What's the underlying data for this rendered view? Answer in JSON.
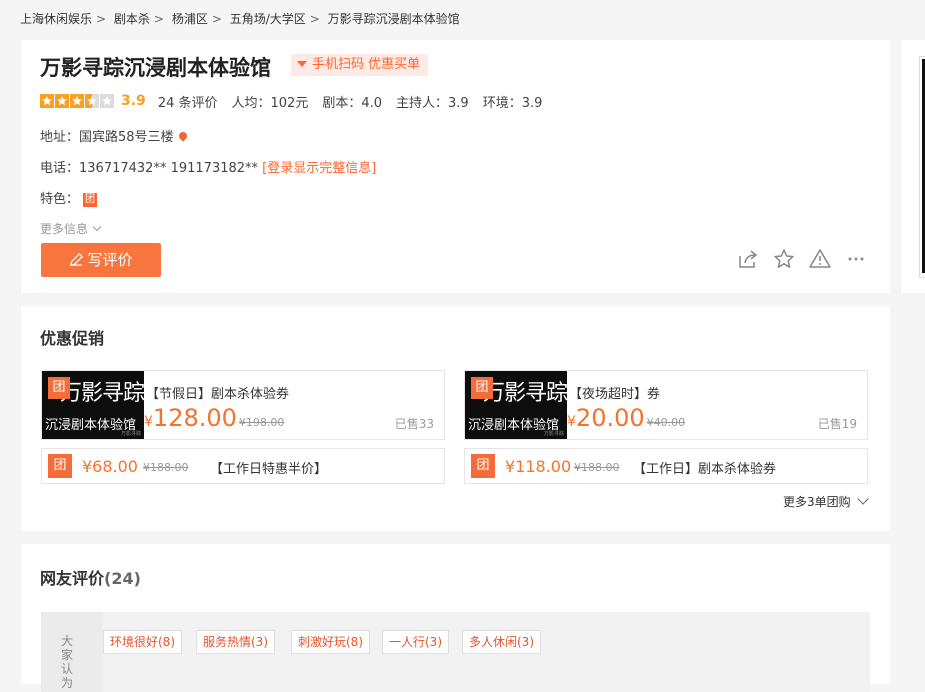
{
  "breadcrumb": [
    {
      "label": "上海休闲娱乐"
    },
    {
      "label": "剧本杀"
    },
    {
      "label": "杨浦区"
    },
    {
      "label": "五角场/大学区"
    },
    {
      "label": "万影寻踪沉浸剧本体验馆"
    }
  ],
  "shop": {
    "name": "万影寻踪沉浸剧本体验馆",
    "scan_tag": "手机扫码 优惠买单",
    "stars": 3.5,
    "score": "3.9",
    "review_count": "24 条评价",
    "avg_price": "人均：102元",
    "script_score": "剧本：4.0",
    "host_score": "主持人：3.9",
    "env_score": "环境：3.9",
    "address_label": "地址：",
    "address": "国宾路58号三楼",
    "phone_label": "电话：",
    "phone": "136717432** 191173182**",
    "login_link": "[登录显示完整信息]",
    "feature_label": "特色：",
    "feature_badge": "团",
    "more_info": "更多信息",
    "write_review": "写评价",
    "colors": {
      "accent": "#ff6633",
      "button": "#f8763d",
      "star": "#f8a021"
    }
  },
  "promo": {
    "title": "优惠促销",
    "deal_image": {
      "big_text": "万影寻踪",
      "sub_text": "沉浸剧本体验馆",
      "tiny_text": "万影寻踪"
    },
    "big_deals": [
      {
        "badge": "团",
        "title": "【节假日】剧本杀体验券",
        "currency": "¥",
        "price": "128.00",
        "orig": "¥198.00",
        "sold": "已售33"
      },
      {
        "badge": "团",
        "title": "【夜场超时】券",
        "currency": "¥",
        "price": "20.00",
        "orig": "¥40.00",
        "sold": "已售19"
      }
    ],
    "small_deals": [
      {
        "badge": "团",
        "price": "¥68.00",
        "orig": "¥188.00",
        "title": "【工作日特惠半价】"
      },
      {
        "badge": "团",
        "price": "¥118.00",
        "orig": "¥188.00",
        "title": "【工作日】剧本杀体验券"
      }
    ],
    "more": "更多3单团购"
  },
  "reviews": {
    "title": "网友评价",
    "count": "(24)",
    "tag_label": "大家认为",
    "tags": [
      "环境很好(8)",
      "服务热情(3)",
      "刺激好玩(8)",
      "一人行(3)",
      "多人休闲(3)"
    ]
  }
}
